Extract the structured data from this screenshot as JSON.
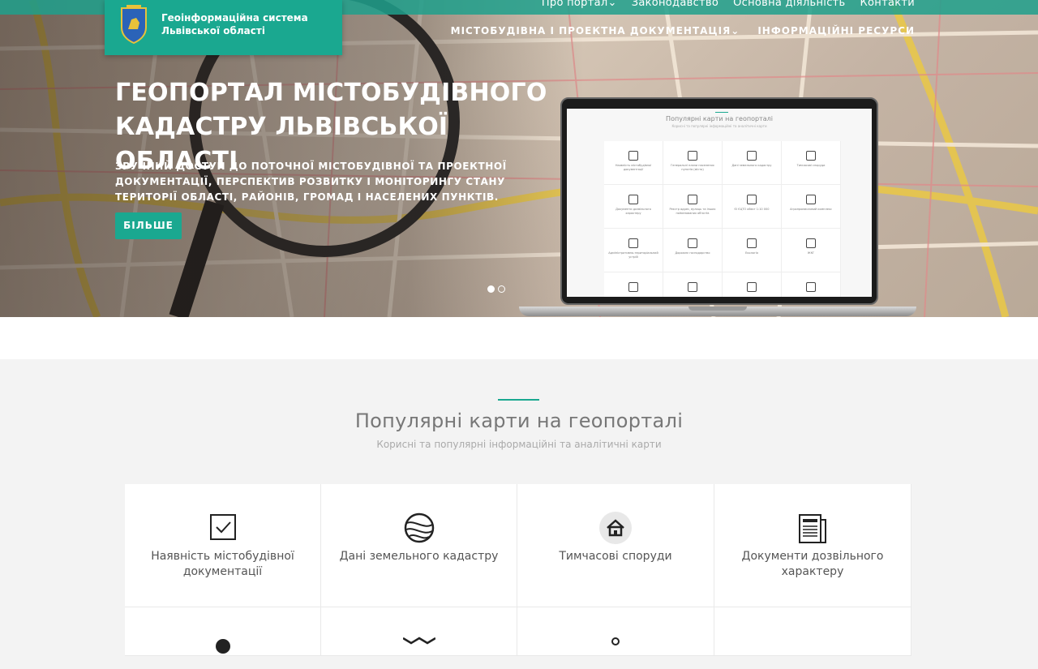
{
  "header": {
    "logo_title": "Геоінформаційна система Львівської області",
    "top_nav": [
      "Про портал",
      "Законодавство",
      "Основна діяльність",
      "Контакти"
    ],
    "main_nav": [
      "МІСТОБУДІВНА І ПРОЕКТНА ДОКУМЕНТАЦІЯ",
      "ІНФОРМАЦІЙНІ РЕСУРСИ"
    ]
  },
  "hero": {
    "title": "ГЕОПОРТАЛ МІСТОБУДІВНОГО КАДАСТРУ ЛЬВІВСЬКОЇ ОБЛАСТІ",
    "subtitle": "ЗРУЧНИЙ ДОСТУП ДО ПОТОЧНОЇ МІСТОБУДІВНОЇ ТА ПРОЕКТНОЇ ДОКУМЕНТАЦІЇ, ПЕРСПЕКТИВ РОЗВИТКУ І МОНІТОРИНГУ СТАНУ ТЕРИТОРІЇ ОБЛАСТІ, РАЙОНІВ, ГРОМАД І НАСЕЛЕНИХ ПУНКТІВ.",
    "button": "БІЛЬШЕ",
    "slides": 2,
    "active_slide": 1
  },
  "laptop_preview": {
    "title": "Популярні карти на геопорталі",
    "subtitle": "Корисні та популярні інформаційні та аналітичні карти",
    "items": [
      "Наявність містобудівної документації",
      "Генеральні плани населених пунктів (місто)",
      "Дані земельного кадастру",
      "Тимчасові споруди",
      "Документи дозвільного характеру",
      "Реєстр адрес, вулиць та інших поіменованих об'єктів",
      "ЄІ ЄЦТО обєкт 1:10 000",
      "Агропромисловий комплекс",
      "Адміністративно-територіальний устрій",
      "Дорожнє господарство",
      "Екологія",
      "ЖКГ",
      "",
      "",
      "",
      ""
    ]
  },
  "popular": {
    "title": "Популярні карти на геопорталі",
    "subtitle": "Корисні та популярні інформаційні та аналітичні карти",
    "cards": [
      {
        "label": "Наявність містобудівної документації",
        "icon": "checkbox-icon"
      },
      {
        "label": "Дані земельного кадастру",
        "icon": "globe-icon"
      },
      {
        "label": "Тимчасові споруди",
        "icon": "house-icon"
      },
      {
        "label": "Документи дозвільного характеру",
        "icon": "newspaper-icon"
      },
      {
        "label": "",
        "icon": "pin-icon"
      },
      {
        "label": "",
        "icon": "map-icon"
      },
      {
        "label": "",
        "icon": "person-icon"
      },
      {
        "label": "",
        "icon": ""
      }
    ]
  },
  "colors": {
    "accent": "#1aa890"
  }
}
